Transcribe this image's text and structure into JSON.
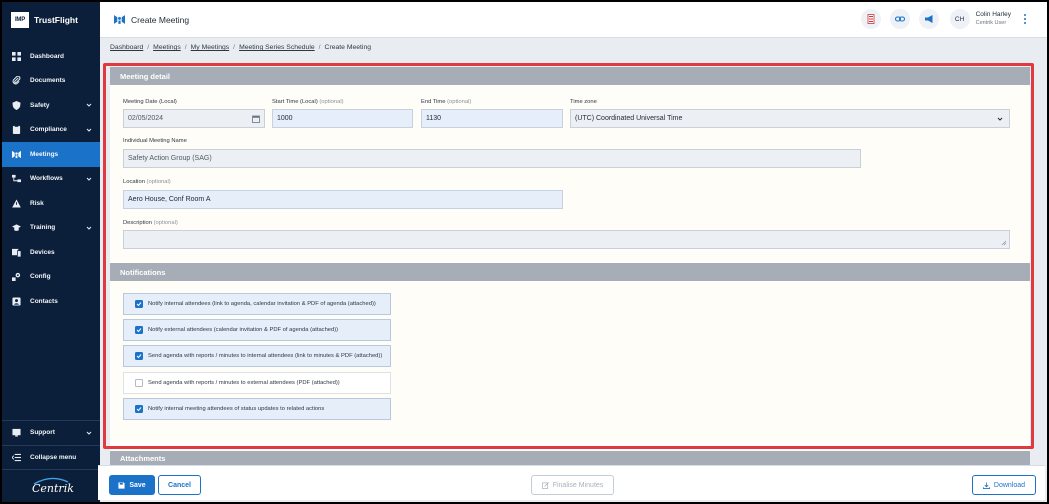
{
  "brand": {
    "logo": "IMP",
    "name": "TrustFlight"
  },
  "header": {
    "title": "Create Meeting",
    "user_initials": "CH",
    "user_name": "Colin Harley",
    "user_role": "Centrik User"
  },
  "sidebar": {
    "items": [
      {
        "label": "Dashboard",
        "icon": "dashboard-icon"
      },
      {
        "label": "Documents",
        "icon": "paperclip-icon"
      },
      {
        "label": "Safety",
        "icon": "shield-icon",
        "chevron": true
      },
      {
        "label": "Compliance",
        "icon": "clipboard-icon",
        "chevron": true
      },
      {
        "label": "Meetings",
        "icon": "meetings-icon",
        "active": true
      },
      {
        "label": "Workflows",
        "icon": "workflow-icon",
        "chevron": true
      },
      {
        "label": "Risk",
        "icon": "warning-icon"
      },
      {
        "label": "Training",
        "icon": "graduation-cap-icon",
        "chevron": true
      },
      {
        "label": "Devices",
        "icon": "devices-icon"
      },
      {
        "label": "Config",
        "icon": "config-icon"
      },
      {
        "label": "Contacts",
        "icon": "contacts-icon"
      }
    ],
    "support_label": "Support",
    "collapse_label": "Collapse menu",
    "footer_logo": "Centrik"
  },
  "breadcrumb": [
    "Dashboard",
    "Meetings",
    "My Meetings",
    "Meeting Series Schedule",
    "Create Meeting"
  ],
  "meeting_detail": {
    "heading": "Meeting detail",
    "date_label": "Meeting Date (Local)",
    "date_value": "02/05/2024",
    "start_label": "Start Time (Local)",
    "start_value": "1000",
    "end_label": "End Time",
    "end_value": "1130",
    "optional": "(optional)",
    "timezone_label": "Time zone",
    "timezone_value": "(UTC) Coordinated Universal Time",
    "name_label": "Individual Meeting Name",
    "name_value": "Safety Action Group (SAG)",
    "location_label": "Location",
    "location_value": "Aero House, Conf Room A",
    "description_label": "Description",
    "description_value": ""
  },
  "notifications": {
    "heading": "Notifications",
    "options": [
      {
        "label": "Notify internal attendees (link to agenda, calendar invitation & PDF of agenda (attached))",
        "checked": true
      },
      {
        "label": "Notify external attendees (calendar invitation & PDF of agenda (attached))",
        "checked": true
      },
      {
        "label": "Send agenda with reports / minutes to internal attendees (link to minutes & PDF (attached))",
        "checked": true
      },
      {
        "label": "Send agenda with reports / minutes to external attendees (PDF (attached))",
        "checked": false
      },
      {
        "label": "Notify internal meeting attendees of status updates to related actions",
        "checked": true
      }
    ]
  },
  "attachments": {
    "heading": "Attachments"
  },
  "footer": {
    "save": "Save",
    "cancel": "Cancel",
    "finalise": "Finalise Minutes",
    "download": "Download"
  },
  "colors": {
    "sidebar_bg": "#0c1f3a",
    "accent": "#1a73c9",
    "highlight": "#e03a3e",
    "section_head": "#a6adb6"
  }
}
